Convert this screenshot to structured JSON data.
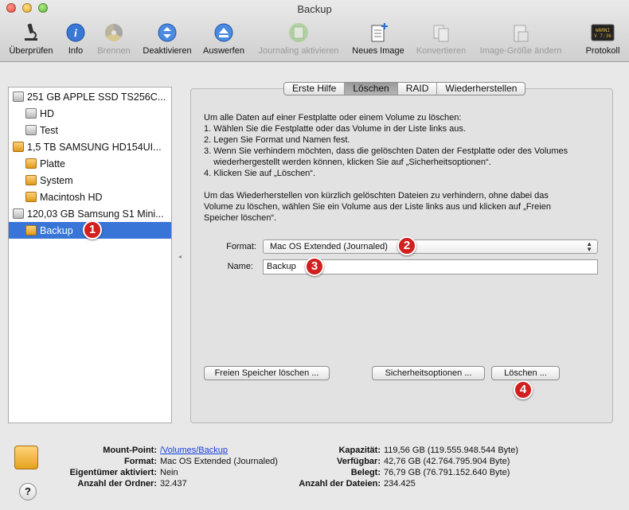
{
  "window": {
    "title": "Backup"
  },
  "toolbar": {
    "items": [
      {
        "label": "Überprüfen",
        "icon": "microscope-icon",
        "enabled": true
      },
      {
        "label": "Info",
        "icon": "info-icon",
        "enabled": true
      },
      {
        "label": "Brennen",
        "icon": "burn-icon",
        "enabled": false
      },
      {
        "label": "Deaktivieren",
        "icon": "unmount-icon",
        "enabled": true
      },
      {
        "label": "Auswerfen",
        "icon": "eject-icon",
        "enabled": true
      },
      {
        "label": "Journaling aktivieren",
        "icon": "journaling-icon",
        "enabled": false
      },
      {
        "label": "Neues Image",
        "icon": "new-image-icon",
        "enabled": true
      },
      {
        "label": "Konvertieren",
        "icon": "convert-icon",
        "enabled": false
      },
      {
        "label": "Image-Größe ändern",
        "icon": "resize-image-icon",
        "enabled": false
      },
      {
        "label": "Protokoll",
        "icon": "log-icon",
        "enabled": true
      }
    ]
  },
  "sidebar": {
    "items": [
      {
        "label": "251 GB APPLE SSD TS256C...",
        "kind": "disk"
      },
      {
        "label": "HD",
        "kind": "volume"
      },
      {
        "label": "Test",
        "kind": "volume"
      },
      {
        "label": "1,5 TB SAMSUNG HD154UI...",
        "kind": "disk"
      },
      {
        "label": "Platte",
        "kind": "volume"
      },
      {
        "label": "System",
        "kind": "volume"
      },
      {
        "label": "Macintosh HD",
        "kind": "volume"
      },
      {
        "label": "120,03 GB Samsung S1 Mini...",
        "kind": "disk"
      },
      {
        "label": "Backup",
        "kind": "volume",
        "selected": true
      }
    ]
  },
  "tabs": [
    "Erste Hilfe",
    "Löschen",
    "RAID",
    "Wiederherstellen"
  ],
  "active_tab": "Löschen",
  "erase": {
    "intro": "Um alle Daten auf einer Festplatte oder einem Volume zu löschen:",
    "steps": [
      "1. Wählen Sie die Festplatte oder das Volume in der Liste links aus.",
      "2. Legen Sie Format und Namen fest.",
      "3. Wenn Sie verhindern möchten, dass die gelöschten Daten der Festplatte oder des Volumes",
      "    wiederhergestellt werden können, klicken Sie auf „Sicherheitsoptionen“.",
      "4. Klicken Sie auf „Löschen“."
    ],
    "free_space_text": [
      "Um das Wiederherstellen von kürzlich gelöschten Dateien zu verhindern, ohne dabei das",
      "Volume zu löschen, wählen Sie ein Volume aus der Liste links aus und klicken auf „Freien",
      "Speicher löschen“."
    ],
    "format_label": "Format:",
    "format_value": "Mac OS Extended (Journaled)",
    "name_label": "Name:",
    "name_value": "Backup",
    "btn_free_space": "Freien Speicher löschen ...",
    "btn_security": "Sicherheitsoptionen ...",
    "btn_erase": "Löschen ..."
  },
  "badges": [
    "1",
    "2",
    "3",
    "4"
  ],
  "info": {
    "left": [
      {
        "label": "Mount-Point:",
        "value": "/Volumes/Backup",
        "link": true
      },
      {
        "label": "Format:",
        "value": "Mac OS Extended (Journaled)"
      },
      {
        "label": "Eigentümer aktiviert:",
        "value": "Nein"
      },
      {
        "label": "Anzahl der Ordner:",
        "value": "32.437"
      }
    ],
    "right": [
      {
        "label": "Kapazität:",
        "value": "119,56 GB (119.555.948.544 Byte)"
      },
      {
        "label": "Verfügbar:",
        "value": "42,76 GB (42.764.795.904 Byte)"
      },
      {
        "label": "Belegt:",
        "value": "76,79 GB (76.791.152.640 Byte)"
      },
      {
        "label": "Anzahl der Dateien:",
        "value": "234.425"
      }
    ]
  },
  "help_label": "?",
  "colors": {
    "selection": "#3875d7",
    "badge": "#d21f1f",
    "link": "#1a3fd6"
  }
}
